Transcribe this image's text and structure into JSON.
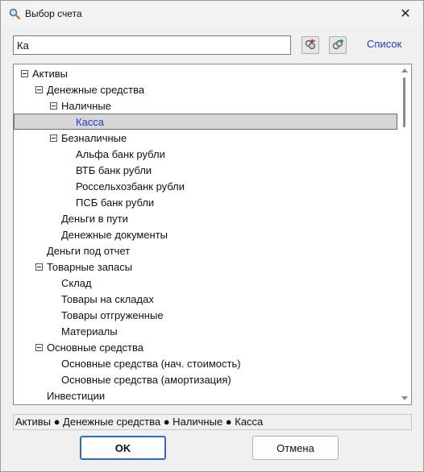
{
  "window": {
    "title": "Выбор счета",
    "icon": "magnifier-icon",
    "close_label": "✕"
  },
  "search": {
    "value": "Ка",
    "placeholder": ""
  },
  "toolbar": {
    "prev_icon": "find-previous-icon",
    "next_icon": "find-next-icon",
    "list_label": "Список"
  },
  "tree": {
    "items": [
      {
        "label": "Активы",
        "level": 0,
        "expandable": true,
        "selected": false
      },
      {
        "label": "Денежные средства",
        "level": 1,
        "expandable": true,
        "selected": false
      },
      {
        "label": "Наличные",
        "level": 2,
        "expandable": true,
        "selected": false
      },
      {
        "label": "Касса",
        "level": 3,
        "expandable": false,
        "selected": true
      },
      {
        "label": "Безналичные",
        "level": 2,
        "expandable": true,
        "selected": false
      },
      {
        "label": "Альфа банк рубли",
        "level": 3,
        "expandable": false,
        "selected": false
      },
      {
        "label": "ВТБ банк рубли",
        "level": 3,
        "expandable": false,
        "selected": false
      },
      {
        "label": "Россельхозбанк рубли",
        "level": 3,
        "expandable": false,
        "selected": false
      },
      {
        "label": "ПСБ банк рубли",
        "level": 3,
        "expandable": false,
        "selected": false
      },
      {
        "label": "Деньги в пути",
        "level": 2,
        "expandable": false,
        "selected": false
      },
      {
        "label": "Денежные документы",
        "level": 2,
        "expandable": false,
        "selected": false
      },
      {
        "label": "Деньги под отчет",
        "level": 1,
        "expandable": false,
        "selected": false
      },
      {
        "label": "Товарные запасы",
        "level": 1,
        "expandable": true,
        "selected": false
      },
      {
        "label": "Склад",
        "level": 2,
        "expandable": false,
        "selected": false
      },
      {
        "label": "Товары на складах",
        "level": 2,
        "expandable": false,
        "selected": false
      },
      {
        "label": "Товары отгруженные",
        "level": 2,
        "expandable": false,
        "selected": false
      },
      {
        "label": "Материалы",
        "level": 2,
        "expandable": false,
        "selected": false
      },
      {
        "label": "Основные средства",
        "level": 1,
        "expandable": true,
        "selected": false
      },
      {
        "label": "Основные средства (нач. стоимость)",
        "level": 2,
        "expandable": false,
        "selected": false
      },
      {
        "label": "Основные средства (амортизация)",
        "level": 2,
        "expandable": false,
        "selected": false
      },
      {
        "label": "Инвестиции",
        "level": 1,
        "expandable": false,
        "selected": false
      }
    ]
  },
  "path": "Активы ● Денежные средства ● Наличные ● Касса",
  "buttons": {
    "ok": "OK",
    "cancel": "Отмена"
  },
  "colors": {
    "link": "#1a3ec8",
    "selected_bg": "#d6d6d6",
    "ok_border": "#2a6bd1"
  }
}
